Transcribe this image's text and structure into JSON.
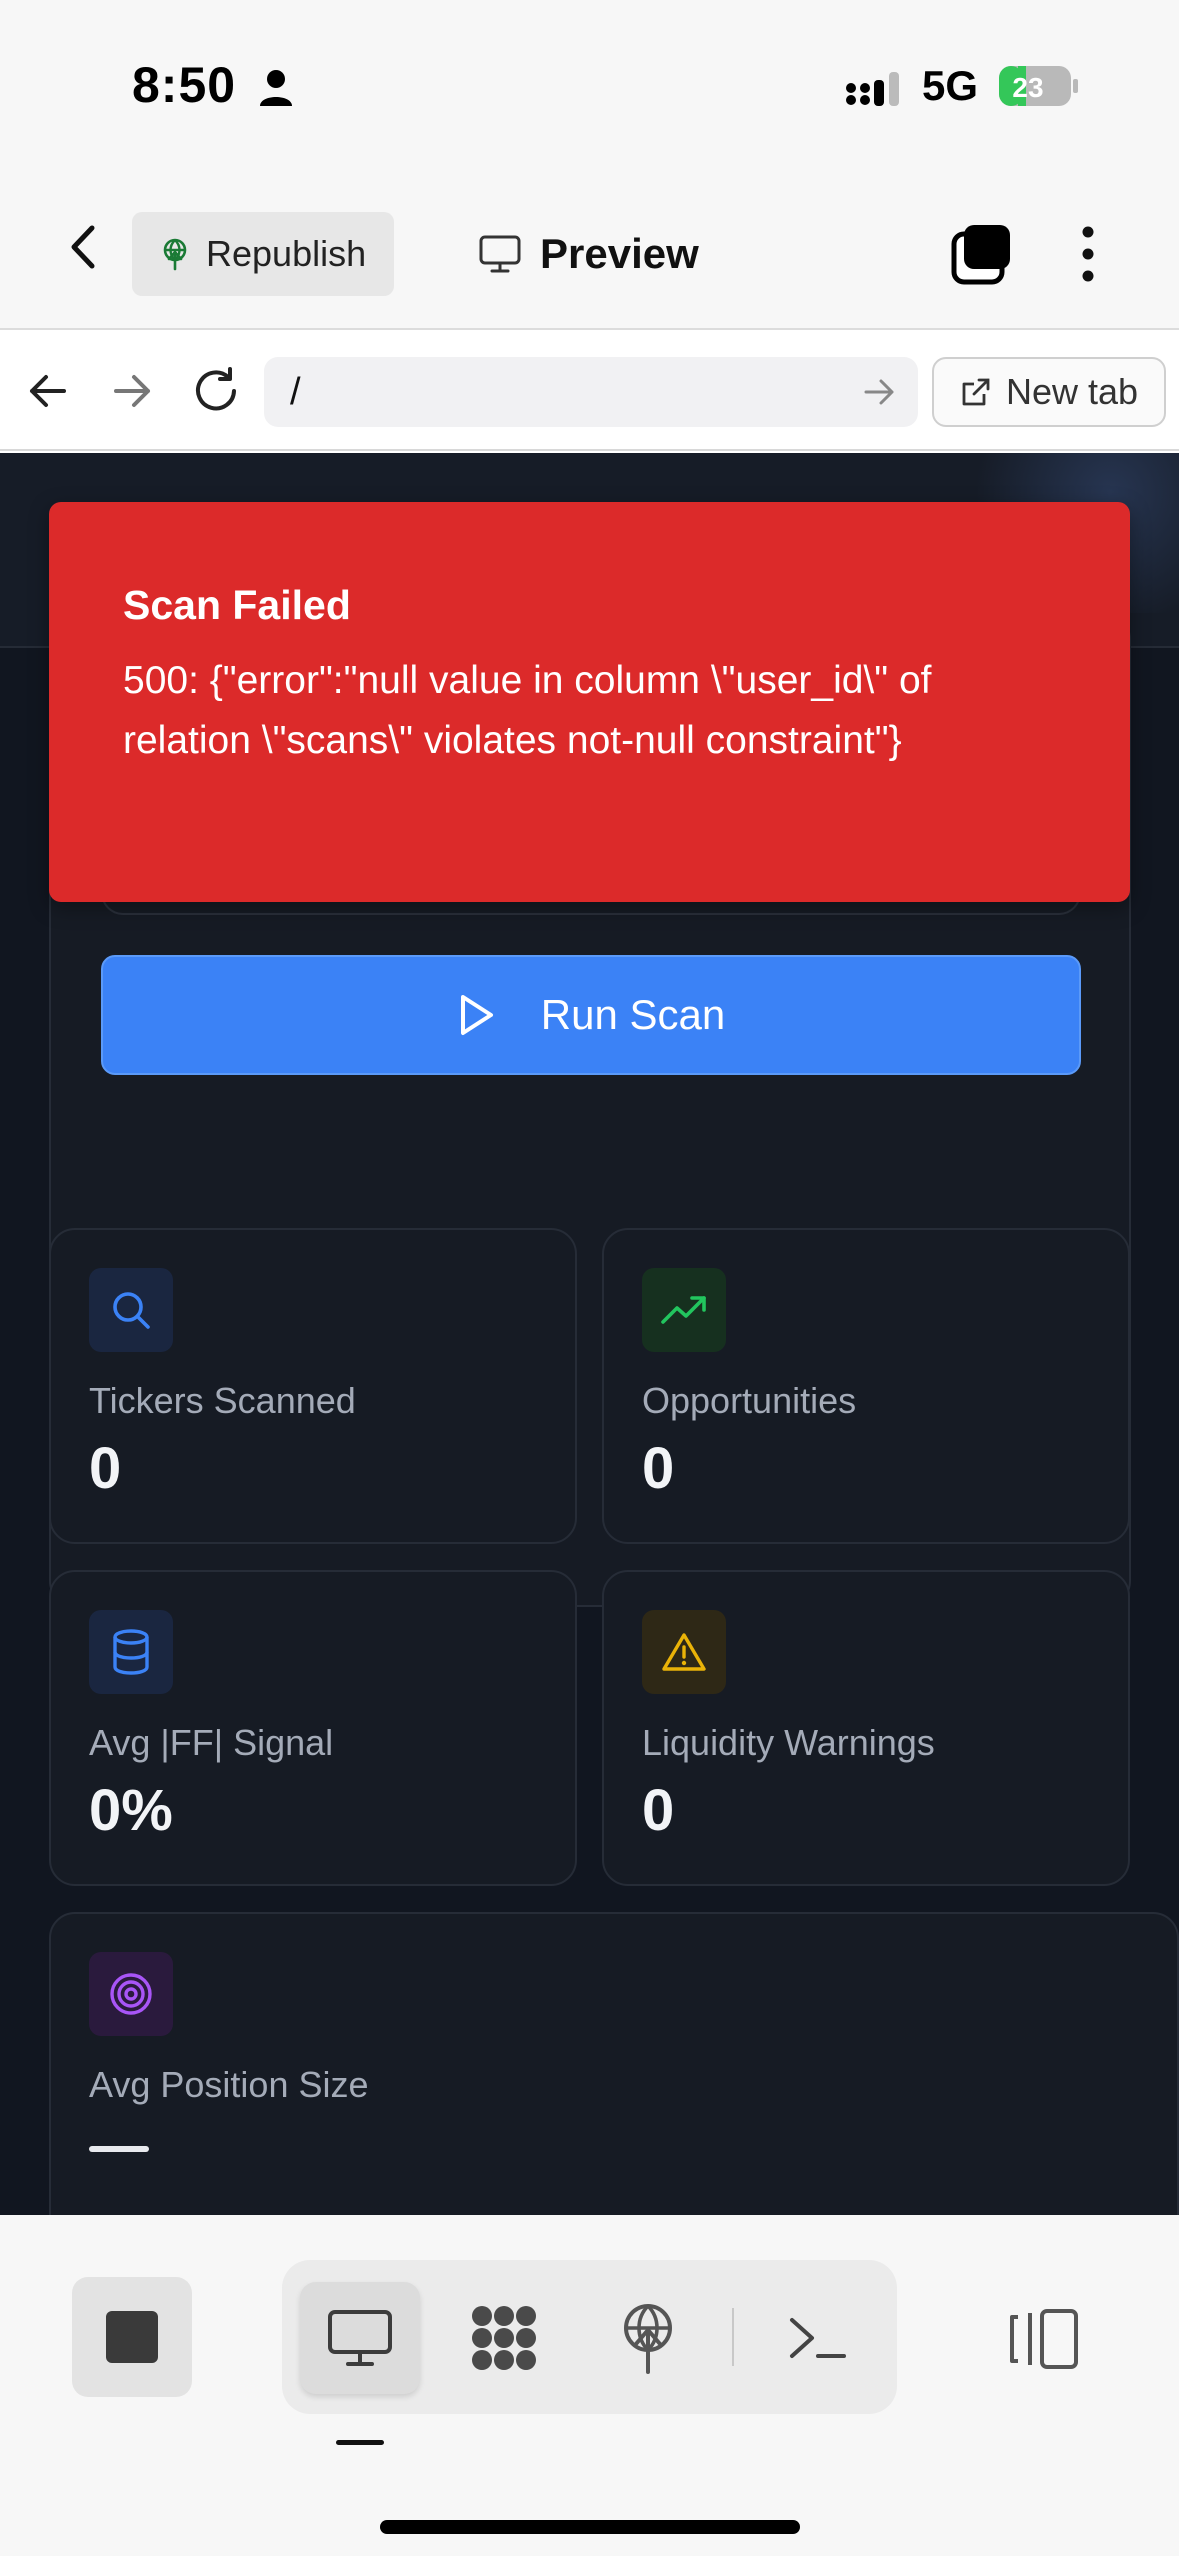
{
  "status_bar": {
    "time": "8:50",
    "network": "5G",
    "battery": "23"
  },
  "header": {
    "republish_label": "Republish",
    "preview_label": "Preview"
  },
  "url_bar": {
    "url": "/",
    "new_tab_label": "New tab"
  },
  "toast": {
    "title": "Scan Failed",
    "message": "500: {\"error\":\"null value in column \\\"user_id\\\" of relation \\\"scans\\\" violates not-null constraint\"}"
  },
  "scan": {
    "run_label": "Run Scan"
  },
  "stats": [
    {
      "label": "Tickers Scanned",
      "value": "0",
      "icon": "search-icon",
      "color": "#3b82f6"
    },
    {
      "label": "Opportunities",
      "value": "0",
      "icon": "trending-up-icon",
      "color": "#22c55e"
    },
    {
      "label": "Avg |FF| Signal",
      "value": "0%",
      "icon": "database-icon",
      "color": "#3b82f6"
    },
    {
      "label": "Liquidity Warnings",
      "value": "0",
      "icon": "warning-icon",
      "color": "#eab308"
    },
    {
      "label": "Avg Position Size",
      "value": "",
      "icon": "target-icon",
      "color": "#a855f7"
    }
  ],
  "colors": {
    "toast_bg": "#dc2a2a",
    "primary": "#3b82f6",
    "page_bg": "#111620",
    "card_bg": "#161b24"
  }
}
